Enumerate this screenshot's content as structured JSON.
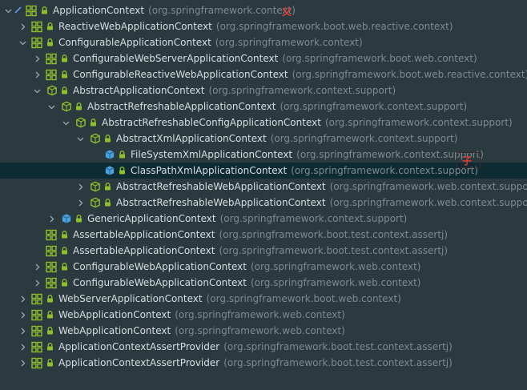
{
  "rows": [
    {
      "indent": 0,
      "arrow": "down",
      "name": "ApplicationContext",
      "pkg": "(org.springframework.context)",
      "icon": "interface",
      "edit": true
    },
    {
      "indent": 1,
      "arrow": "right",
      "name": "ReactiveWebApplicationContext",
      "pkg": "(org.springframework.boot.web.reactive.context)",
      "icon": "interface"
    },
    {
      "indent": 1,
      "arrow": "down",
      "name": "ConfigurableApplicationContext",
      "pkg": "(org.springframework.context)",
      "icon": "interface"
    },
    {
      "indent": 2,
      "arrow": "right",
      "name": "ConfigurableWebServerApplicationContext",
      "pkg": "(org.springframework.boot.web.context)",
      "icon": "interface"
    },
    {
      "indent": 2,
      "arrow": "right",
      "name": "ConfigurableReactiveWebApplicationContext",
      "pkg": "(org.springframework.boot.web.reactive.context)",
      "icon": "interface"
    },
    {
      "indent": 2,
      "arrow": "down",
      "name": "AbstractApplicationContext",
      "pkg": "(org.springframework.context.support)",
      "icon": "abstract"
    },
    {
      "indent": 3,
      "arrow": "down",
      "name": "AbstractRefreshableApplicationContext",
      "pkg": "(org.springframework.context.support)",
      "icon": "abstract"
    },
    {
      "indent": 4,
      "arrow": "down",
      "name": "AbstractRefreshableConfigApplicationContext",
      "pkg": "(org.springframework.context.support)",
      "icon": "abstract"
    },
    {
      "indent": 5,
      "arrow": "down",
      "name": "AbstractXmlApplicationContext",
      "pkg": "(org.springframework.context.support)",
      "icon": "abstract"
    },
    {
      "indent": 6,
      "arrow": "none",
      "name": "FileSystemXmlApplicationContext",
      "pkg": "(org.springframework.context.support)",
      "icon": "class"
    },
    {
      "indent": 6,
      "arrow": "none",
      "name": "ClassPathXmlApplicationContext",
      "pkg": "(org.springframework.context.support)",
      "icon": "class",
      "selected": true
    },
    {
      "indent": 5,
      "arrow": "right",
      "name": "AbstractRefreshableWebApplicationContext",
      "pkg": "(org.springframework.web.context.support)",
      "icon": "abstract"
    },
    {
      "indent": 5,
      "arrow": "right",
      "name": "AbstractRefreshableWebApplicationContext",
      "pkg": "(org.springframework.web.context.support)",
      "icon": "abstract"
    },
    {
      "indent": 3,
      "arrow": "right",
      "name": "GenericApplicationContext",
      "pkg": "(org.springframework.context.support)",
      "icon": "class"
    },
    {
      "indent": 2,
      "arrow": "none",
      "name": "AssertableApplicationContext",
      "pkg": "(org.springframework.boot.test.context.assertj)",
      "icon": "interface"
    },
    {
      "indent": 2,
      "arrow": "none",
      "name": "AssertableApplicationContext",
      "pkg": "(org.springframework.boot.test.context.assertj)",
      "icon": "interface"
    },
    {
      "indent": 2,
      "arrow": "right",
      "name": "ConfigurableWebApplicationContext",
      "pkg": "(org.springframework.web.context)",
      "icon": "interface"
    },
    {
      "indent": 2,
      "arrow": "right",
      "name": "ConfigurableWebApplicationContext",
      "pkg": "(org.springframework.web.context)",
      "icon": "interface"
    },
    {
      "indent": 1,
      "arrow": "right",
      "name": "WebServerApplicationContext",
      "pkg": "(org.springframework.boot.web.context)",
      "icon": "interface"
    },
    {
      "indent": 1,
      "arrow": "right",
      "name": "WebApplicationContext",
      "pkg": "(org.springframework.web.context)",
      "icon": "interface"
    },
    {
      "indent": 1,
      "arrow": "right",
      "name": "WebApplicationContext",
      "pkg": "(org.springframework.web.context)",
      "icon": "interface"
    },
    {
      "indent": 1,
      "arrow": "right",
      "name": "ApplicationContextAssertProvider",
      "pkg": "(org.springframework.boot.test.context.assertj)",
      "icon": "interface"
    },
    {
      "indent": 1,
      "arrow": "right",
      "name": "ApplicationContextAssertProvider",
      "pkg": "(org.springframework.boot.test.context.assertj)",
      "icon": "interface"
    }
  ],
  "notes": {
    "parent": "父",
    "child": "子"
  },
  "colors": {
    "background": "#2b3a3f",
    "selected_row": "#0e2a33",
    "interface_icon": "#8fbf2a",
    "abstract_icon": "#8fbf2a",
    "class_icon": "#4aa3df",
    "lock": "#8fbf2a",
    "annotation": "#e53935"
  }
}
